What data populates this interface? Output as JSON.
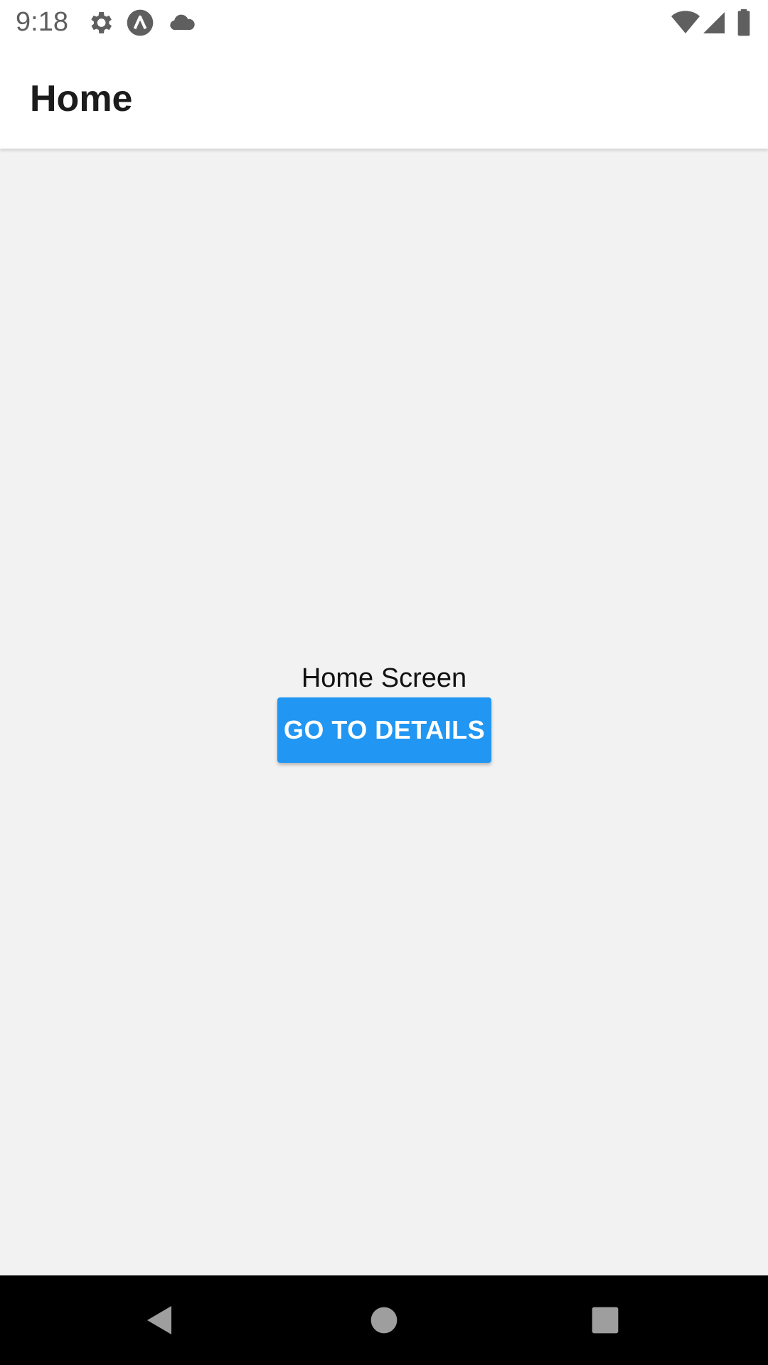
{
  "status_bar": {
    "time": "9:18",
    "left_icons": [
      "settings-gear-icon",
      "app-logo-icon",
      "cloud-icon"
    ],
    "right_icons": [
      "wifi-icon",
      "cell-signal-icon",
      "battery-icon"
    ]
  },
  "app_bar": {
    "title": "Home"
  },
  "main": {
    "label": "Home Screen",
    "button_label": "GO TO DETAILS"
  },
  "nav_bar": {
    "buttons": [
      "back-icon",
      "home-icon",
      "recents-icon"
    ]
  },
  "colors": {
    "accent": "#2196f3",
    "background": "#f2f2f2",
    "app_bar": "#ffffff",
    "nav_bar": "#000000"
  }
}
